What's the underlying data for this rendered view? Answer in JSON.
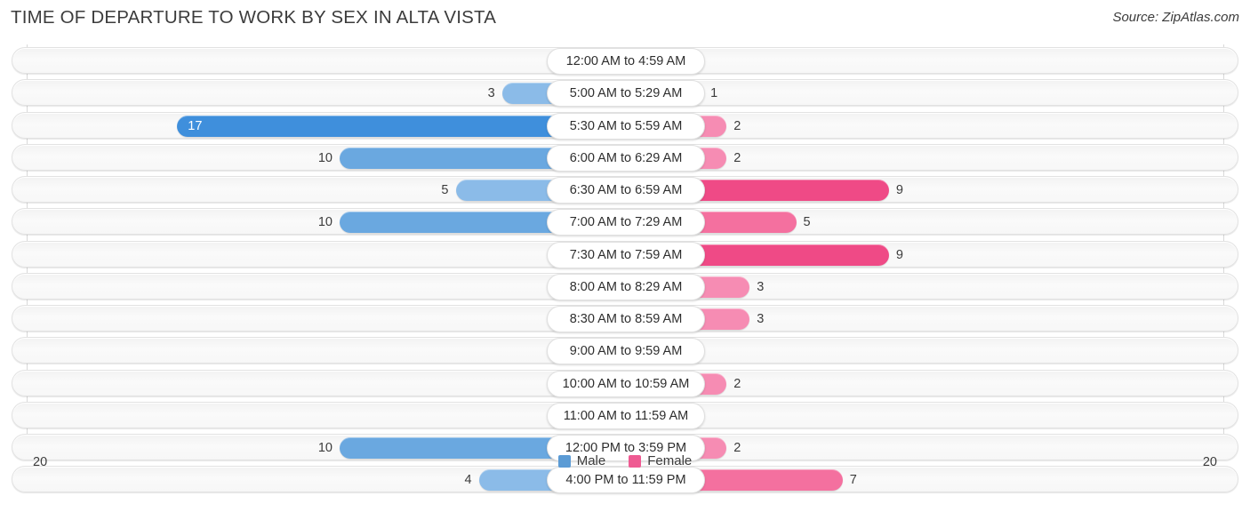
{
  "header": {
    "title": "TIME OF DEPARTURE TO WORK BY SEX IN ALTA VISTA",
    "source": "Source: ZipAtlas.com"
  },
  "axis": {
    "left_label": "20",
    "right_label": "20"
  },
  "legend": {
    "items": [
      {
        "label": "Male",
        "color": "#5b9bd5"
      },
      {
        "label": "Female",
        "color": "#ef5a92"
      }
    ]
  },
  "colors": {
    "male_max": "#3f8fdc",
    "male_high": "#6aa8e0",
    "male_mid": "#8bbbe8",
    "male_low": "#a8cbee",
    "female_max": "#ef4a86",
    "female_high": "#f4709f",
    "female_mid": "#f68cb3",
    "female_low": "#f9afc9",
    "row_bg": "#f7f7f7",
    "gridline": "#d9d9d9"
  },
  "chart_data": {
    "type": "bar",
    "orientation": "horizontal-diverging",
    "title": "TIME OF DEPARTURE TO WORK BY SEX IN ALTA VISTA",
    "xlabel": "",
    "ylabel": "",
    "xlim": [
      20,
      20
    ],
    "axis_max": 20,
    "grid": false,
    "legend_position": "bottom-center",
    "categories": [
      "12:00 AM to 4:59 AM",
      "5:00 AM to 5:29 AM",
      "5:30 AM to 5:59 AM",
      "6:00 AM to 6:29 AM",
      "6:30 AM to 6:59 AM",
      "7:00 AM to 7:29 AM",
      "7:30 AM to 7:59 AM",
      "8:00 AM to 8:29 AM",
      "8:30 AM to 8:59 AM",
      "9:00 AM to 9:59 AM",
      "10:00 AM to 10:59 AM",
      "11:00 AM to 11:59 AM",
      "12:00 PM to 3:59 PM",
      "4:00 PM to 11:59 PM"
    ],
    "series": [
      {
        "name": "Male",
        "color": "#5b9bd5",
        "values": [
          0,
          3,
          17,
          10,
          5,
          10,
          0,
          0,
          0,
          0,
          0,
          0,
          10,
          4
        ]
      },
      {
        "name": "Female",
        "color": "#ef5a92",
        "values": [
          0,
          1,
          2,
          2,
          9,
          5,
          9,
          3,
          3,
          0,
          2,
          0,
          2,
          7
        ]
      }
    ]
  },
  "rows": [
    {
      "category": "12:00 AM to 4:59 AM",
      "male": "0",
      "female": "0"
    },
    {
      "category": "5:00 AM to 5:29 AM",
      "male": "3",
      "female": "1"
    },
    {
      "category": "5:30 AM to 5:59 AM",
      "male": "17",
      "female": "2"
    },
    {
      "category": "6:00 AM to 6:29 AM",
      "male": "10",
      "female": "2"
    },
    {
      "category": "6:30 AM to 6:59 AM",
      "male": "5",
      "female": "9"
    },
    {
      "category": "7:00 AM to 7:29 AM",
      "male": "10",
      "female": "5"
    },
    {
      "category": "7:30 AM to 7:59 AM",
      "male": "0",
      "female": "9"
    },
    {
      "category": "8:00 AM to 8:29 AM",
      "male": "0",
      "female": "3"
    },
    {
      "category": "8:30 AM to 8:59 AM",
      "male": "0",
      "female": "3"
    },
    {
      "category": "9:00 AM to 9:59 AM",
      "male": "0",
      "female": "0"
    },
    {
      "category": "10:00 AM to 10:59 AM",
      "male": "0",
      "female": "2"
    },
    {
      "category": "11:00 AM to 11:59 AM",
      "male": "0",
      "female": "0"
    },
    {
      "category": "12:00 PM to 3:59 PM",
      "male": "10",
      "female": "2"
    },
    {
      "category": "4:00 PM to 11:59 PM",
      "male": "4",
      "female": "7"
    }
  ]
}
